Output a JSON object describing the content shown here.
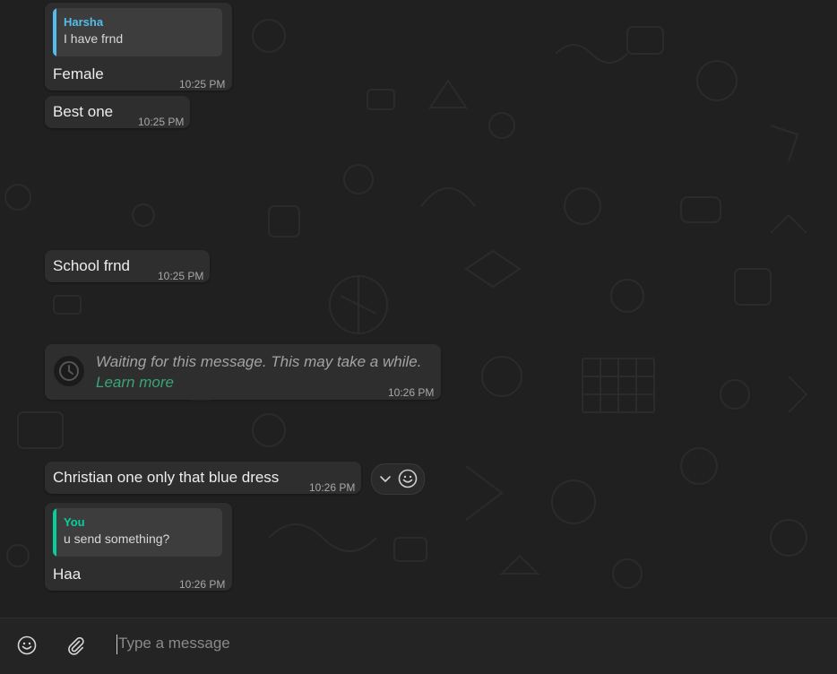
{
  "colors": {
    "background": "#202020",
    "bubble": "#2e2e2e",
    "quote_background": "#3d3d3d",
    "quote_bar_other": "#53bdeb",
    "quote_bar_you": "#06cf9c",
    "link": "#3aa57a"
  },
  "messages": [
    {
      "quote": {
        "author": "Harsha",
        "text": "I have frnd"
      },
      "text": "Female",
      "time": "10:25 PM"
    },
    {
      "text": "Best one",
      "time": "10:25 PM"
    },
    {
      "text": "School frnd",
      "time": "10:25 PM"
    },
    {
      "waiting_text": "Waiting for this message. This may take a while.",
      "link_text": "Learn more",
      "time": "10:26 PM",
      "icon": "clock-icon"
    },
    {
      "text": "Christian one only that blue dress",
      "time": "10:26 PM"
    },
    {
      "quote": {
        "author": "You",
        "text": "u send something?"
      },
      "text": "Haa",
      "time": "10:26 PM"
    }
  ],
  "hover_actions": {
    "icons": [
      "chevron-down-icon",
      "emoji-reaction-icon"
    ]
  },
  "composer": {
    "placeholder": "Type a message",
    "icons": [
      "emoji-icon",
      "attach-icon"
    ]
  }
}
